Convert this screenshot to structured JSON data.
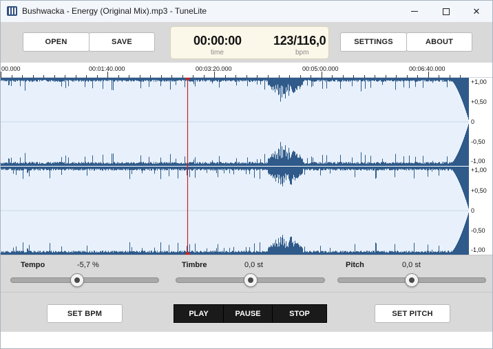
{
  "window": {
    "title": "Bushwacka - Energy (Original Mix).mp3 - TuneLite",
    "controls": {
      "minimize": "minimize-icon",
      "maximize": "maximize-icon",
      "close": "✕"
    }
  },
  "toolbar": {
    "open_label": "OPEN",
    "save_label": "SAVE",
    "settings_label": "SETTINGS",
    "about_label": "ABOUT"
  },
  "display": {
    "time_value": "00:00:00",
    "time_label": "time",
    "bpm_value": "123/116,0",
    "bpm_label": "bpm"
  },
  "timeline": {
    "ticks": [
      "00.000",
      "00:01:40.000",
      "00:03:20.000",
      "00:05:00.000",
      "00:06:40.000"
    ]
  },
  "amplitude_scale": {
    "upper": [
      "+1,00",
      "+0,50",
      "0",
      "-0,50",
      "-1,00"
    ],
    "lower": [
      "+1,00",
      "+0,50",
      "0",
      "-0,50",
      "-1,00"
    ]
  },
  "waveform": {
    "background_color": "#e8f1fb",
    "wave_color": "#2f5a8a",
    "cursor_color": "#d21f1f",
    "cursor_position_fraction": 0.398
  },
  "controls": {
    "tempo": {
      "label": "Tempo",
      "value": "-5,7 %",
      "position_fraction": 0.45
    },
    "timbre": {
      "label": "Timbre",
      "value": "0,0 st",
      "position_fraction": 0.5
    },
    "pitch": {
      "label": "Pitch",
      "value": "0,0 st",
      "position_fraction": 0.5
    }
  },
  "bottom_bar": {
    "set_bpm_label": "SET BPM",
    "play_label": "PLAY",
    "pause_label": "PAUSE",
    "stop_label": "STOP",
    "set_pitch_label": "SET PITCH"
  }
}
